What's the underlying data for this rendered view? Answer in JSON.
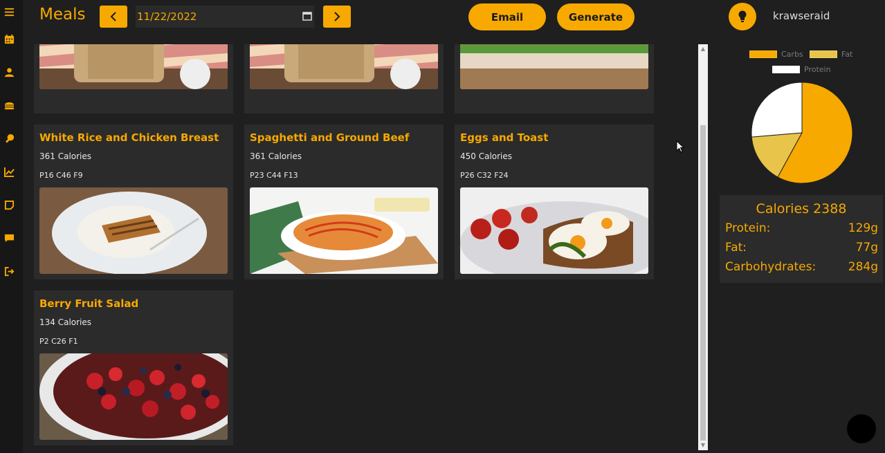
{
  "sidebar": {
    "icons": [
      "menu-icon",
      "calendar-icon",
      "user-icon",
      "meal-icon",
      "drumstick-icon",
      "chart-icon",
      "note-icon",
      "chat-icon",
      "logout-icon"
    ]
  },
  "header": {
    "title": "Meals",
    "date": "11/22/2022",
    "email_label": "Email",
    "generate_label": "Generate",
    "username": "krawseraid"
  },
  "meals": [
    {
      "title": "",
      "calories": "",
      "macros": "",
      "image": "oatmeal-jar"
    },
    {
      "title": "",
      "calories": "",
      "macros": "",
      "image": "oatmeal-jar"
    },
    {
      "title": "",
      "calories": "",
      "macros": "",
      "image": "sandwich"
    },
    {
      "title": "White Rice and Chicken Breast",
      "calories": "361 Calories",
      "macros": "P16 C46 F9",
      "image": "rice-chicken"
    },
    {
      "title": "Spaghetti and Ground Beef",
      "calories": "361 Calories",
      "macros": "P23 C44 F13",
      "image": "spaghetti"
    },
    {
      "title": "Eggs and Toast",
      "calories": "450 Calories",
      "macros": "P26 C32 F24",
      "image": "eggs-toast"
    },
    {
      "title": "Berry Fruit Salad",
      "calories": "134 Calories",
      "macros": "P2 C26 F1",
      "image": "berries"
    }
  ],
  "chart_data": {
    "type": "pie",
    "categories": [
      "Carbs",
      "Fat",
      "Protein"
    ],
    "values": [
      284,
      77,
      129
    ],
    "colors": [
      "#f7a900",
      "#e8c44a",
      "#ffffff"
    ]
  },
  "summary": {
    "calories": "Calories 2388",
    "protein_label": "Protein:",
    "protein_value": "129g",
    "fat_label": "Fat:",
    "fat_value": "77g",
    "carbs_label": "Carbohydrates:",
    "carbs_value": "284g"
  },
  "colors": {
    "accent": "#f7a900",
    "background": "#1f1f1f",
    "card": "#2b2b2b"
  }
}
